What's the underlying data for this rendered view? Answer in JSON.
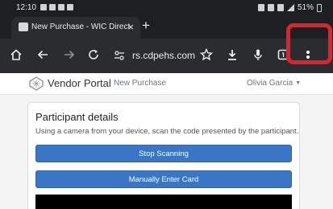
{
  "status_bar": {
    "time": "12:10",
    "battery": "51%"
  },
  "browser": {
    "tab_title": "New Purchase - WIC Direct V",
    "tab_close": "×",
    "new_tab": "+",
    "url": "rs.cdpehs.com",
    "highlight_color": "#e4202b"
  },
  "navbar": {
    "brand": "Vendor Portal",
    "breadcrumb": "New Purchase",
    "user_name": "Olivia Garcia",
    "caret": "▼"
  },
  "participant": {
    "title": "Participant details",
    "description": "Using a camera from your device, scan the code presented by the participant.",
    "stop_button": "Stop Scanning",
    "manual_button": "Manually Enter Card",
    "button_color": "#3a76c6"
  }
}
